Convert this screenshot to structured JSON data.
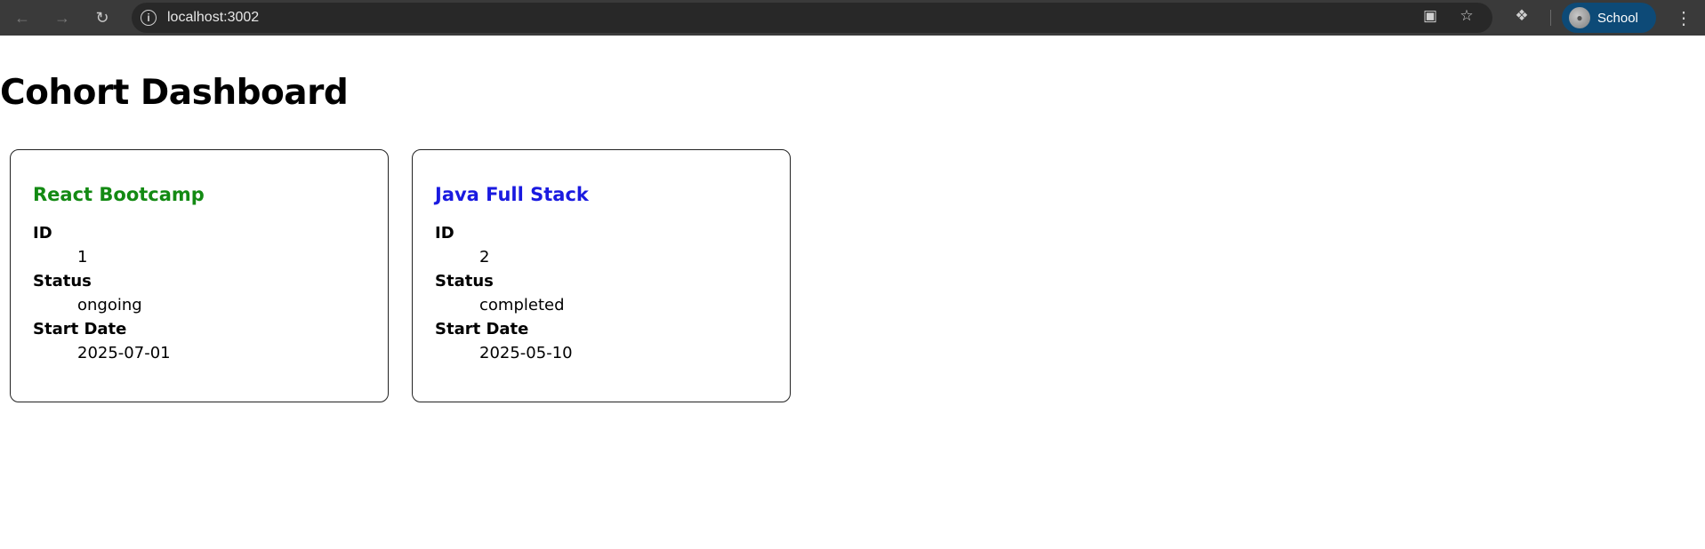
{
  "browser": {
    "url": "localhost:3002",
    "profile_name": "School"
  },
  "page": {
    "title": "Cohort Dashboard"
  },
  "cohorts": [
    {
      "name": "React Bootcamp",
      "name_color": "#138a13",
      "id_label": "ID",
      "id": "1",
      "status_label": "Status",
      "status": "ongoing",
      "start_label": "Start Date",
      "start_date": "2025-07-01"
    },
    {
      "name": "Java Full Stack",
      "name_color": "#1a1ae0",
      "id_label": "ID",
      "id": "2",
      "status_label": "Status",
      "status": "completed",
      "start_label": "Start Date",
      "start_date": "2025-05-10"
    }
  ]
}
